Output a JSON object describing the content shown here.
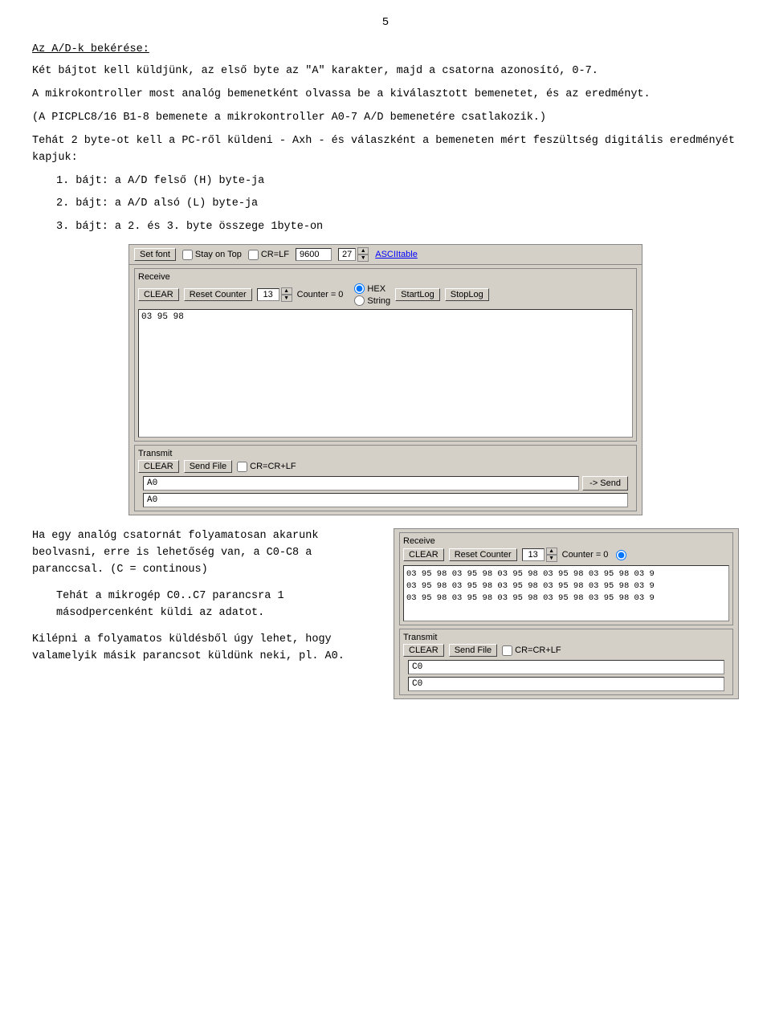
{
  "page": {
    "number": "5"
  },
  "content": {
    "heading": "Az A/D-k bekérése:",
    "para1": "Két bájtot kell küldjünk, az első byte az \"A\" karakter, majd a csatorna azonosító, 0-7.",
    "para2": "A mikrokontroller most analóg bemenetként olvassa be a kiválasztott bemenetet, és az eredményt.",
    "para3": "(A PICPLC8/16 B1-8 bemenete a mikrokontroller A0-7 A/D bemenetére csatlakozik.)",
    "para4": "Tehát 2 byte-ot kell a PC-ről küldeni -  Axh - és válaszként a bemeneten mért feszültség digitális eredményét kapjuk:",
    "list": [
      "1. bájt: a A/D felső (H) byte-ja",
      "2. bájt: a A/D alsó  (L) byte-ja",
      "3. bájt: a 2. és 3. byte összege 1byte-on"
    ]
  },
  "terminal1": {
    "toolbar": {
      "setfont_label": "Set font",
      "stay_on_top_label": "Stay on Top",
      "crlf_label": "CR=LF",
      "speed_value": "9600",
      "counter_value": "27",
      "ascii_table_label": "ASCIItable"
    },
    "receive": {
      "section_label": "Receive",
      "clear_label": "CLEAR",
      "reset_counter_label": "Reset Counter",
      "counter_num": "13",
      "counter_eq_label": "Counter = 0",
      "hex_label": "HEX",
      "string_label": "String",
      "startlog_label": "StartLog",
      "stoplog_label": "StopLog",
      "data": "03 95 98"
    },
    "transmit": {
      "section_label": "Transmit",
      "clear_label": "CLEAR",
      "send_file_label": "Send File",
      "cr_label": "CR=CR+LF",
      "input_value": "A0",
      "bottom_value": "A0",
      "send_label": "-> Send"
    }
  },
  "bottom_text": {
    "para1": "Ha  egy  analóg  csatornát folyamatosan akarunk beolvasni, erre is lehetőség van, a C0-C8 a paranccsal. (C = continous)",
    "para2": "Tehát a mikrogép C0..C7 parancsra 1 másodpercenként küldi az adatot.",
    "para3": "Kilépni a folyamatos küldésből úgy lehet, hogy valamelyik másik parancsot küldünk neki, pl. A0."
  },
  "terminal2": {
    "receive": {
      "section_label": "Receive",
      "clear_label": "CLEAR",
      "reset_counter_label": "Reset Counter",
      "counter_num": "13",
      "counter_eq_label": "Counter = 0",
      "data_line1": "03 95 98 03 95 98 03 95 98 03 95 98 03 95 98 03 9",
      "data_line2": "03 95 98 03 95 98 03 95 98 03 95 98 03 95 98 03 9",
      "data_line3": "03 95 98 03 95 98 03 95 98 03 95 98 03 95 98 03 9"
    },
    "transmit": {
      "section_label": "Transmit",
      "clear_label": "CLEAR",
      "send_file_label": "Send File",
      "cr_label": "CR=CR+LF",
      "input_value": "C0",
      "bottom_value": "C0"
    }
  }
}
